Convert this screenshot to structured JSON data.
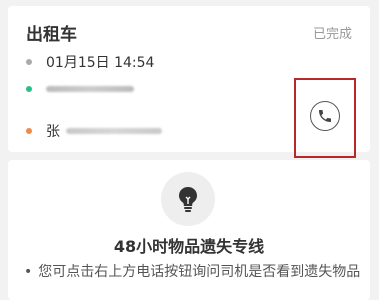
{
  "trip": {
    "title": "出租车",
    "status": "已完成",
    "time": "01月15日 14:54",
    "end_prefix": "张",
    "call_icon": "phone-icon"
  },
  "lost": {
    "icon": "lightbulb-icon",
    "title": "48小时物品遗失专线",
    "bullet": "您可点击右上方电话按钮询问司机是否看到遗失物品"
  },
  "colors": {
    "accent_red": "#b42a2a",
    "start_dot": "#2bbf88",
    "end_dot": "#f08a4b"
  }
}
